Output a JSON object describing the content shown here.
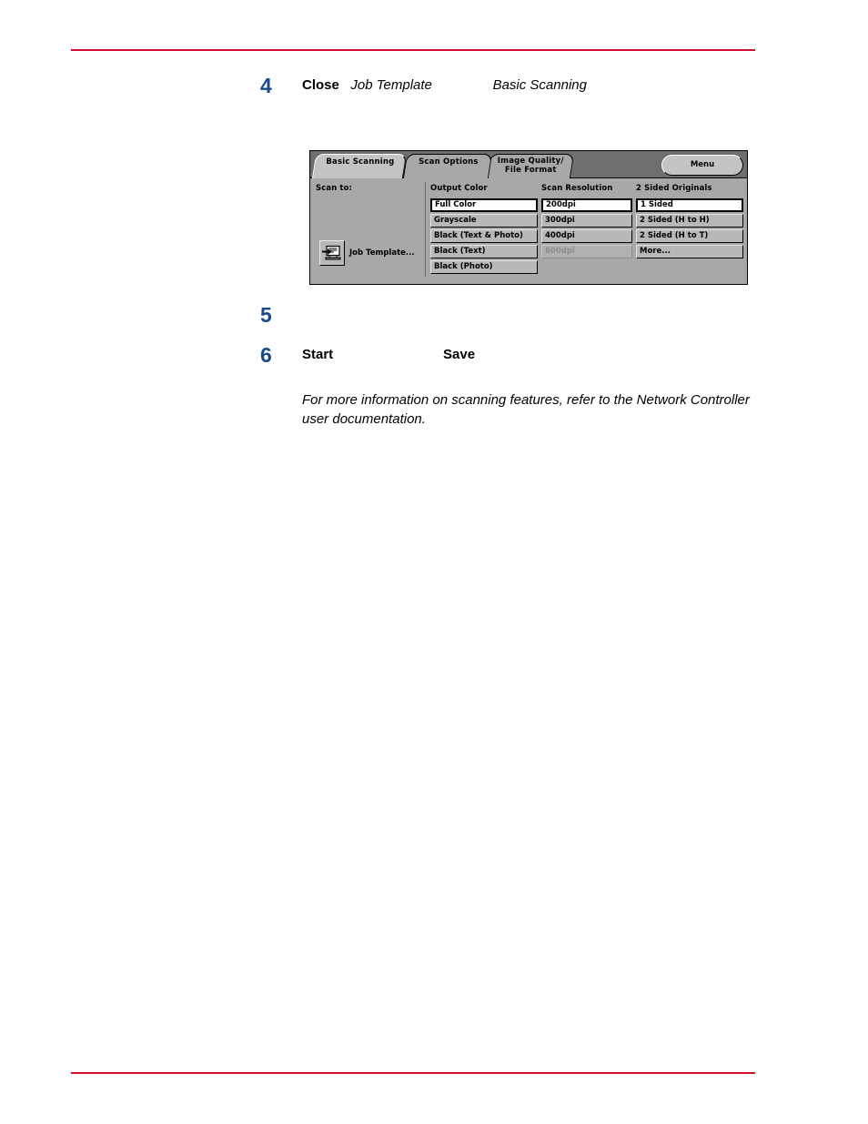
{
  "page": {
    "rule_color": "#d40d2e",
    "step_number_color": "#1b4a8b"
  },
  "steps": [
    {
      "number": "4",
      "runs": [
        {
          "text": "Close",
          "style": "bold"
        },
        {
          "text": "   ",
          "style": "hidden"
        },
        {
          "text": "Job Template",
          "style": "italic"
        },
        {
          "text": "                ",
          "style": "hidden"
        },
        {
          "text": "Basic Scanning",
          "style": "italic"
        }
      ]
    },
    {
      "number": "5",
      "runs": []
    },
    {
      "number": "6",
      "runs": [
        {
          "text": "Start",
          "style": "bold"
        },
        {
          "text": "                             ",
          "style": "hidden"
        },
        {
          "text": "Save",
          "style": "bold"
        }
      ]
    }
  ],
  "note": "For more information on scanning features, refer to the Network Controller user documentation.",
  "panel": {
    "tabs": [
      {
        "id": "basic-scanning",
        "label": "Basic Scanning",
        "active": true
      },
      {
        "id": "scan-options",
        "label": "Scan Options",
        "active": false
      },
      {
        "id": "image-quality",
        "label": "Image Quality/\nFile Format",
        "active": false
      }
    ],
    "menu_button_label": "Menu",
    "scan_to": {
      "header": "Scan to:",
      "job_template_label": "Job Template...",
      "job_template_icon": "job-template-icon"
    },
    "columns": [
      {
        "id": "output-color",
        "header": "Output Color",
        "options": [
          {
            "label": "Full Color",
            "state": "selected"
          },
          {
            "label": "Grayscale",
            "state": "normal"
          },
          {
            "label": "Black (Text & Photo)",
            "state": "normal"
          },
          {
            "label": "Black (Text)",
            "state": "normal"
          },
          {
            "label": "Black (Photo)",
            "state": "normal"
          }
        ]
      },
      {
        "id": "scan-resolution",
        "header": "Scan Resolution",
        "options": [
          {
            "label": "200dpi",
            "state": "selected"
          },
          {
            "label": "300dpi",
            "state": "normal"
          },
          {
            "label": "400dpi",
            "state": "normal"
          },
          {
            "label": "600dpi",
            "state": "disabled"
          }
        ]
      },
      {
        "id": "two-sided-originals",
        "header": "2 Sided Originals",
        "options": [
          {
            "label": "1 Sided",
            "state": "selected"
          },
          {
            "label": "2 Sided (H to H)",
            "state": "normal"
          },
          {
            "label": "2 Sided (H to T)",
            "state": "normal"
          },
          {
            "label": "More...",
            "state": "normal"
          }
        ]
      }
    ]
  }
}
